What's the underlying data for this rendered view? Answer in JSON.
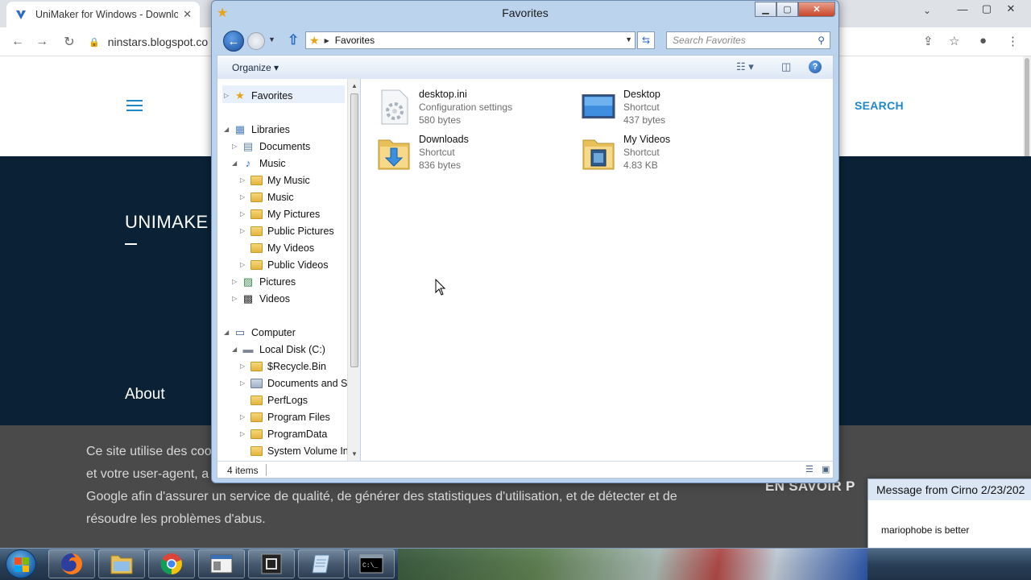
{
  "browser": {
    "tab_title": "UniMaker for Windows - Download",
    "tab_close": "✕",
    "url": "ninstars.blogspot.co",
    "window_controls": [
      "—",
      "▢",
      "✕"
    ],
    "site": {
      "search_label": "SEARCH",
      "title": "UNIMAKE",
      "about": "About",
      "cookie_lines": [
        "Ce site utilise des coo",
        "et votre user-agent, a",
        "Google afin d'assurer un service de qualité, de générer des statistiques d'utilisation, et de détecter et de",
        "résoudre les problèmes d'abus."
      ],
      "learn_more": "EN SAVOIR P"
    }
  },
  "explorer": {
    "title": "Favorites",
    "controls": {
      "minimize": "▁",
      "maximize": "▢",
      "close": "✕"
    },
    "address": "Favorites",
    "search_placeholder": "Search Favorites",
    "organize_label": "Organize ▾",
    "nav": [
      {
        "label": "Favorites",
        "level": 0,
        "arrow": "▷",
        "icon": "star-icon"
      },
      {
        "label": "Libraries",
        "level": 0,
        "arrow": "◢",
        "icon": "libraries-icon"
      },
      {
        "label": "Documents",
        "level": 1,
        "arrow": "▷",
        "icon": "documents-icon"
      },
      {
        "label": "Music",
        "level": 1,
        "arrow": "◢",
        "icon": "music-icon"
      },
      {
        "label": "My Music",
        "level": 2,
        "arrow": "▷",
        "icon": "folder-icon"
      },
      {
        "label": "Music",
        "level": 2,
        "arrow": "▷",
        "icon": "folder-icon"
      },
      {
        "label": "My Pictures",
        "level": 2,
        "arrow": "▷",
        "icon": "folder-icon"
      },
      {
        "label": "Public Pictures",
        "level": 2,
        "arrow": "▷",
        "icon": "folder-icon"
      },
      {
        "label": "My Videos",
        "level": 2,
        "arrow": "",
        "icon": "folder-icon"
      },
      {
        "label": "Public Videos",
        "level": 2,
        "arrow": "▷",
        "icon": "folder-icon"
      },
      {
        "label": "Pictures",
        "level": 1,
        "arrow": "▷",
        "icon": "pictures-icon"
      },
      {
        "label": "Videos",
        "level": 1,
        "arrow": "▷",
        "icon": "videos-icon"
      },
      {
        "label": "Computer",
        "level": 0,
        "arrow": "◢",
        "icon": "computer-icon"
      },
      {
        "label": "Local Disk (C:)",
        "level": 1,
        "arrow": "◢",
        "icon": "disk-icon"
      },
      {
        "label": "$Recycle.Bin",
        "level": 2,
        "arrow": "▷",
        "icon": "folder-icon"
      },
      {
        "label": "Documents and Se",
        "level": 2,
        "arrow": "▷",
        "icon": "folder-shortcut-icon"
      },
      {
        "label": "PerfLogs",
        "level": 2,
        "arrow": "",
        "icon": "folder-icon"
      },
      {
        "label": "Program Files",
        "level": 2,
        "arrow": "▷",
        "icon": "folder-icon"
      },
      {
        "label": "ProgramData",
        "level": 2,
        "arrow": "▷",
        "icon": "folder-icon"
      },
      {
        "label": "System Volume Inf",
        "level": 2,
        "arrow": "",
        "icon": "folder-icon"
      }
    ],
    "files": [
      {
        "name": "desktop.ini",
        "type": "Configuration settings",
        "size": "580 bytes",
        "icon": "config-file-icon"
      },
      {
        "name": "Desktop",
        "type": "Shortcut",
        "size": "437 bytes",
        "icon": "desktop-shortcut-icon"
      },
      {
        "name": "Downloads",
        "type": "Shortcut",
        "size": "836 bytes",
        "icon": "downloads-folder-icon"
      },
      {
        "name": "My Videos",
        "type": "Shortcut",
        "size": "4.83 KB",
        "icon": "videos-folder-icon"
      }
    ],
    "status": "4 items"
  },
  "notification": {
    "title": "Message from Cirno 2/23/202",
    "body": "mariophobe is better"
  },
  "taskbar": {
    "buttons": [
      "firefox-icon",
      "explorer-icon",
      "chrome-icon",
      "app-window-icon",
      "app-dark-icon",
      "notepad-icon",
      "cmd-icon"
    ],
    "cmd_label": "C:\\_"
  }
}
